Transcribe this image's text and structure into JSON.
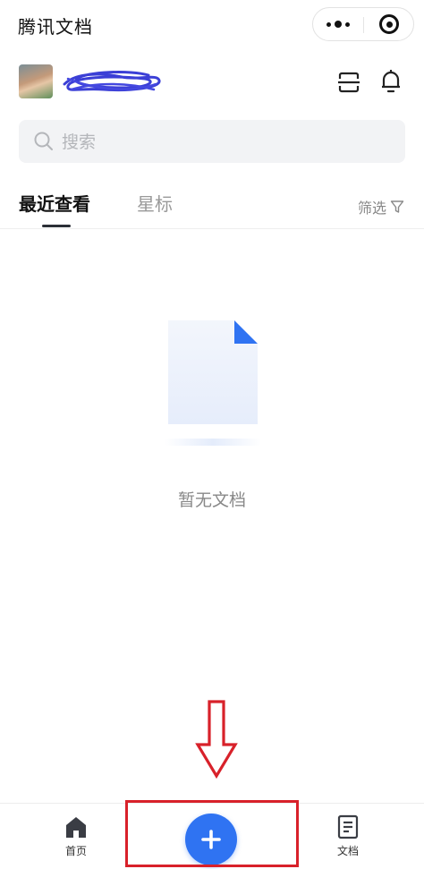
{
  "app": {
    "title": "腾讯文档"
  },
  "header": {
    "avatar_alt": "user-avatar",
    "scan_icon": "scan-icon",
    "bell_icon": "bell-icon"
  },
  "search": {
    "placeholder": "搜索"
  },
  "tabs": {
    "items": [
      {
        "label": "最近查看",
        "active": true
      },
      {
        "label": "星标",
        "active": false
      }
    ],
    "filter_label": "筛选"
  },
  "empty_state": {
    "text": "暂无文档"
  },
  "bottom_nav": {
    "items": [
      {
        "label": "首页",
        "icon": "home-icon"
      },
      {
        "label": "",
        "icon": "plus-icon"
      },
      {
        "label": "文档",
        "icon": "document-icon"
      }
    ]
  },
  "colors": {
    "accent": "#2f73f2",
    "annotation": "#d8212a"
  }
}
